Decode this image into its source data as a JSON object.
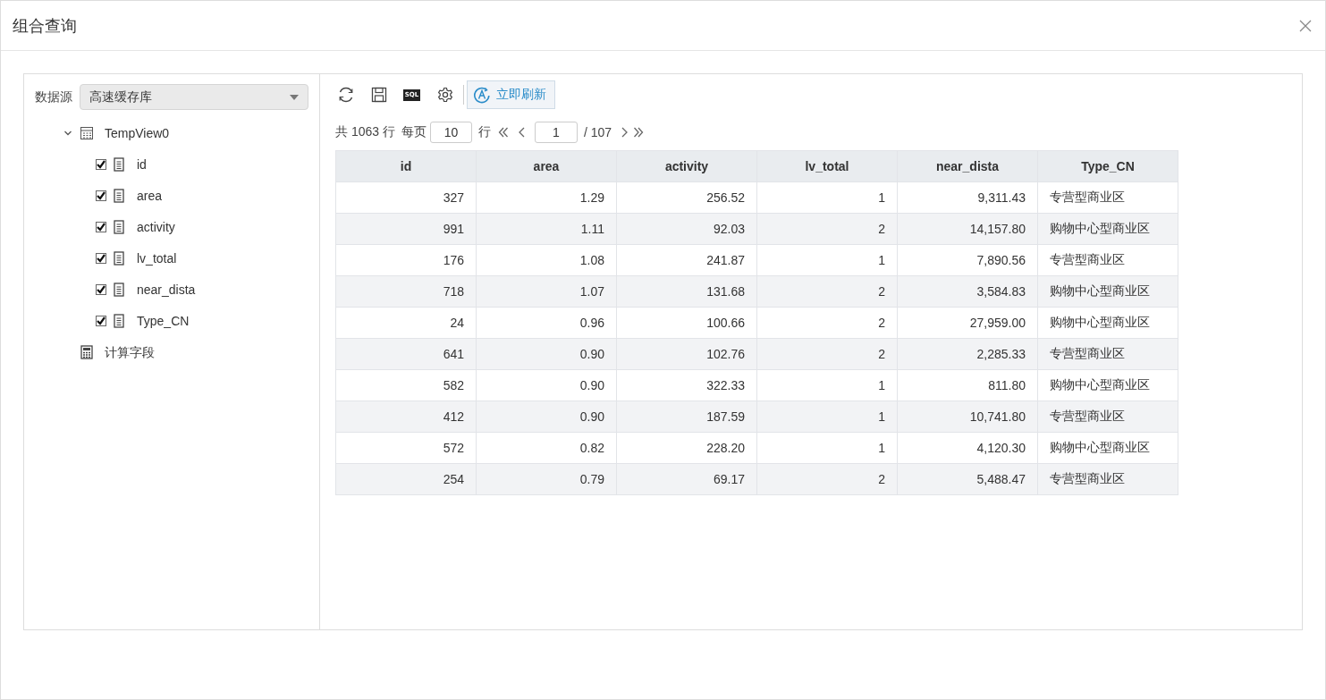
{
  "window": {
    "title": "组合查询"
  },
  "datasource": {
    "label": "数据源",
    "value": "高速缓存库"
  },
  "tree": {
    "items": [
      {
        "label": "TempView0",
        "kind": "table",
        "expanded": true,
        "children": [
          {
            "label": "id",
            "kind": "field",
            "checked": true
          },
          {
            "label": "area",
            "kind": "field",
            "checked": true
          },
          {
            "label": "activity",
            "kind": "field",
            "checked": true
          },
          {
            "label": "lv_total",
            "kind": "field",
            "checked": true
          },
          {
            "label": "near_dista",
            "kind": "field",
            "checked": true
          },
          {
            "label": "Type_CN",
            "kind": "field",
            "checked": true
          }
        ]
      },
      {
        "label": "计算字段",
        "kind": "calc"
      }
    ]
  },
  "toolbar": {
    "sql_icon_text": "SQL",
    "refresh_button": "立即刷新"
  },
  "pagination": {
    "total_text": "共 1063 行",
    "per_page_label": "每页",
    "per_page": "10",
    "per_page_suffix": "行",
    "page": "1",
    "page_total": "/ 107"
  },
  "table": {
    "columns": [
      {
        "label": "id",
        "kind": "number"
      },
      {
        "label": "area",
        "kind": "number"
      },
      {
        "label": "activity",
        "kind": "number"
      },
      {
        "label": "lv_total",
        "kind": "number"
      },
      {
        "label": "near_dista",
        "kind": "number"
      },
      {
        "label": "Type_CN",
        "kind": "text"
      }
    ],
    "rows": [
      [
        "327",
        "1.29",
        "256.52",
        "1",
        "9,311.43",
        "专营型商业区"
      ],
      [
        "991",
        "1.11",
        "92.03",
        "2",
        "14,157.80",
        "购物中心型商业区"
      ],
      [
        "176",
        "1.08",
        "241.87",
        "1",
        "7,890.56",
        "专营型商业区"
      ],
      [
        "718",
        "1.07",
        "131.68",
        "2",
        "3,584.83",
        "购物中心型商业区"
      ],
      [
        "24",
        "0.96",
        "100.66",
        "2",
        "27,959.00",
        "购物中心型商业区"
      ],
      [
        "641",
        "0.90",
        "102.76",
        "2",
        "2,285.33",
        "专营型商业区"
      ],
      [
        "582",
        "0.90",
        "322.33",
        "1",
        "811.80",
        "购物中心型商业区"
      ],
      [
        "412",
        "0.90",
        "187.59",
        "1",
        "10,741.80",
        "专营型商业区"
      ],
      [
        "572",
        "0.82",
        "228.20",
        "1",
        "4,120.30",
        "购物中心型商业区"
      ],
      [
        "254",
        "0.79",
        "69.17",
        "2",
        "5,488.47",
        "专营型商业区"
      ]
    ]
  }
}
